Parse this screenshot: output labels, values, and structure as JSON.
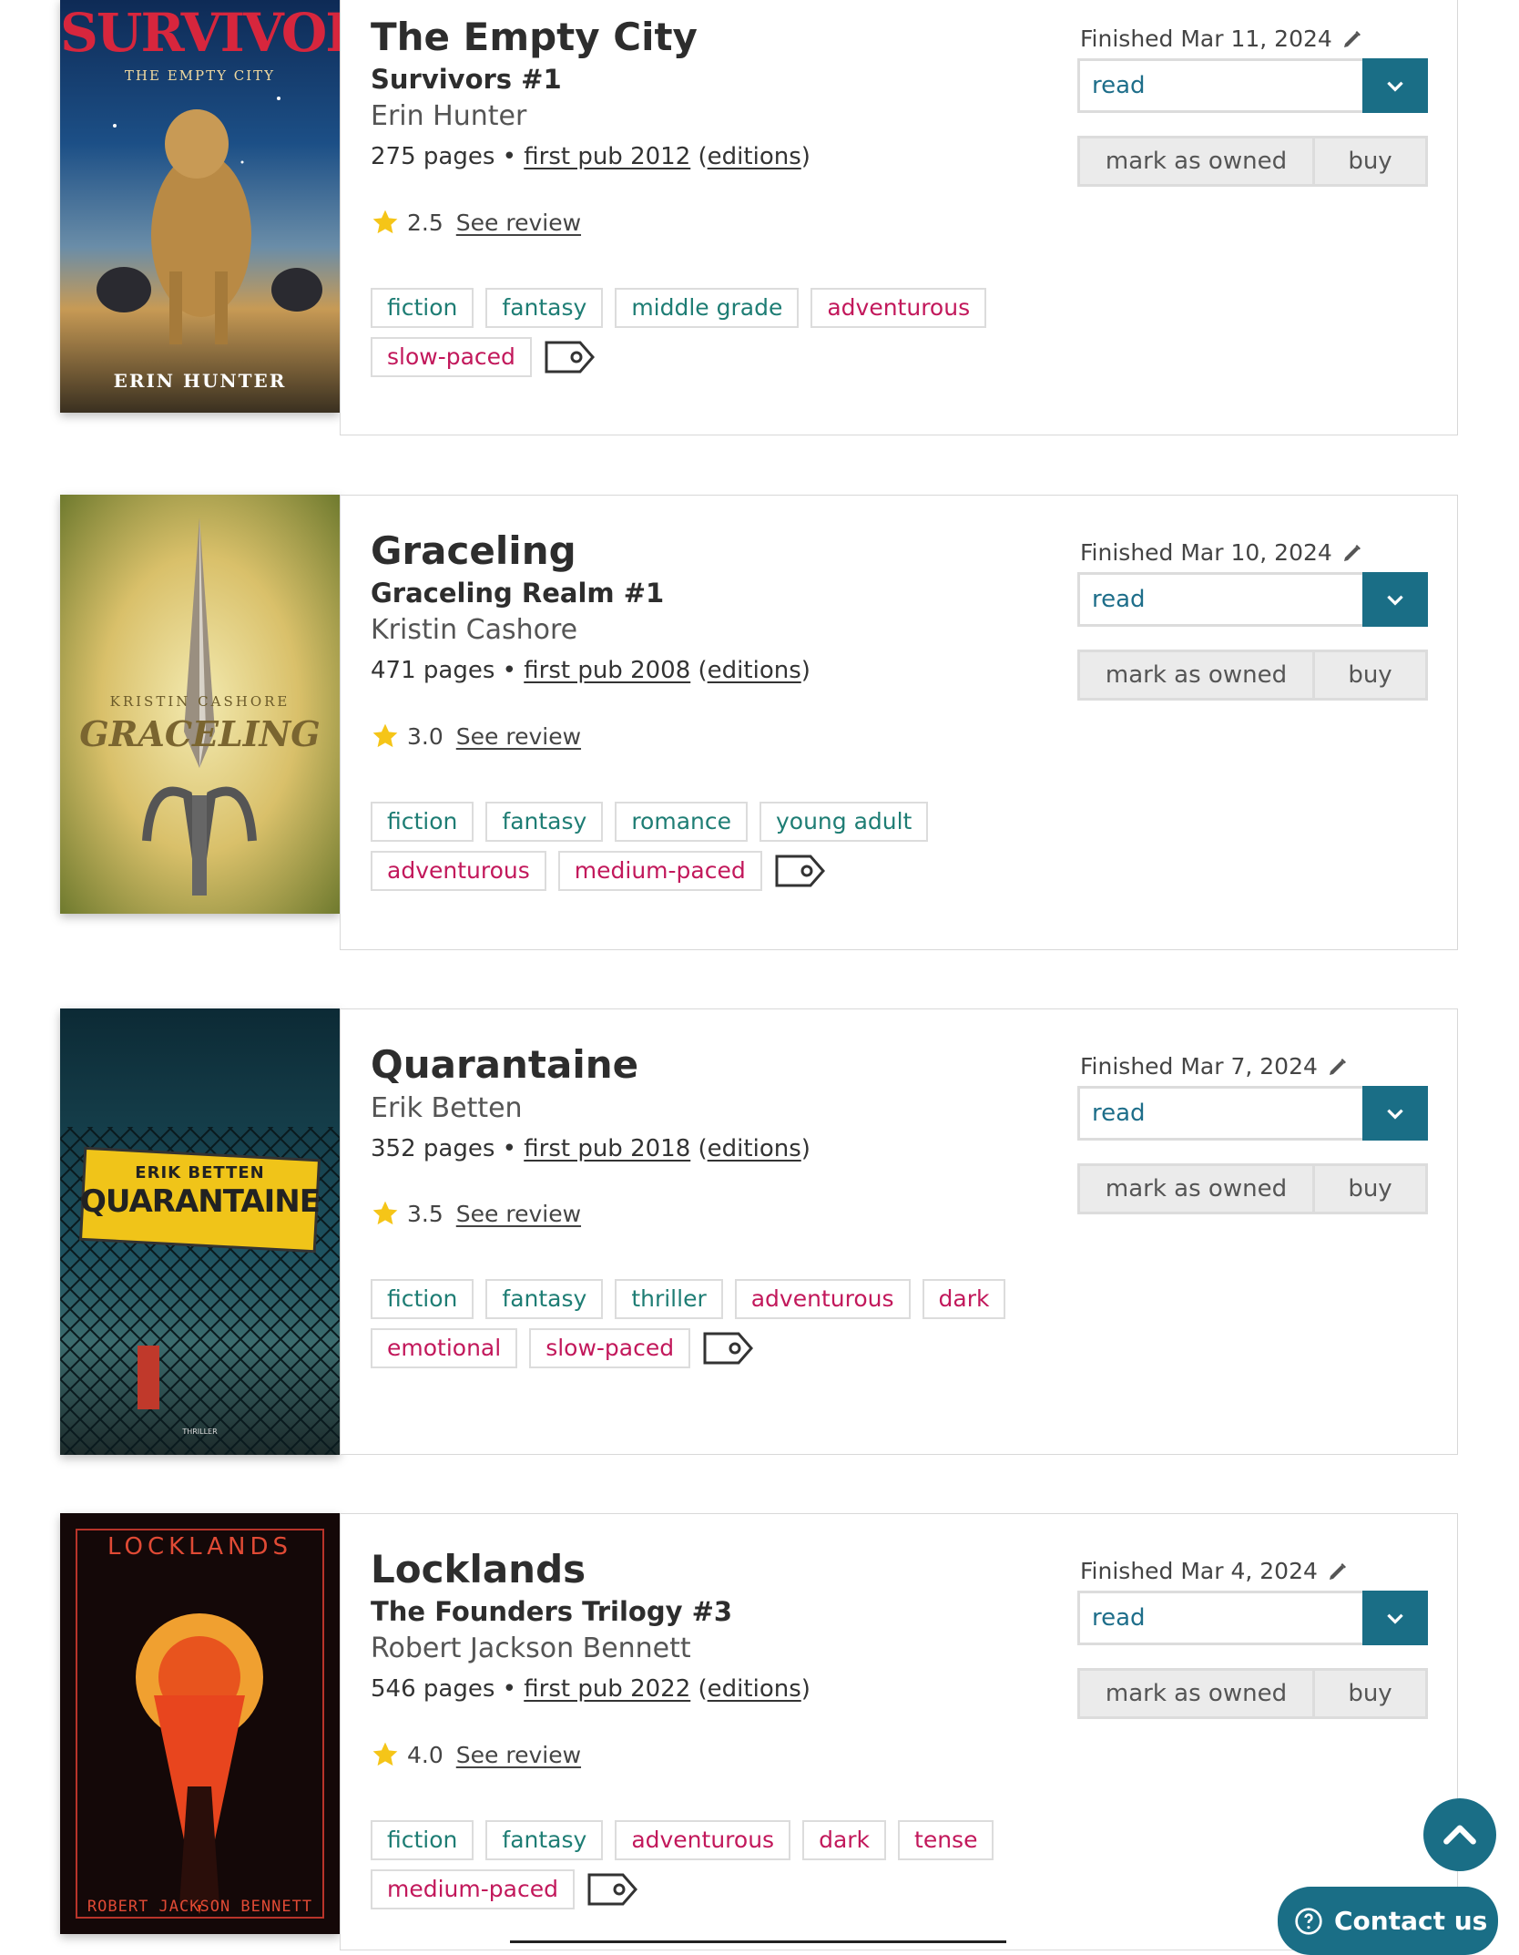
{
  "books": [
    {
      "title": "The Empty City",
      "series": "Survivors #1",
      "author": "Erin Hunter",
      "pages": "275 pages",
      "first_pub": "first pub 2012",
      "editions": "editions",
      "rating": "2.5",
      "see_review": "See review",
      "finished": "Finished Mar 11, 2024",
      "status": "read",
      "mark_owned": "mark as owned",
      "buy": "buy",
      "tags": [
        {
          "label": "fiction",
          "color": "green"
        },
        {
          "label": "fantasy",
          "color": "green"
        },
        {
          "label": "middle grade",
          "color": "green"
        },
        {
          "label": "adventurous",
          "color": "pink"
        },
        {
          "label": "slow-paced",
          "color": "pink"
        }
      ],
      "cover": {
        "top_text": "SURVIVORS",
        "sub_text": "THE EMPTY CITY",
        "byline": "ERIN HUNTER"
      }
    },
    {
      "title": "Graceling",
      "series": "Graceling Realm #1",
      "author": "Kristin Cashore",
      "pages": "471 pages",
      "first_pub": "first pub 2008",
      "editions": "editions",
      "rating": "3.0",
      "see_review": "See review",
      "finished": "Finished Mar 10, 2024",
      "status": "read",
      "mark_owned": "mark as owned",
      "buy": "buy",
      "tags": [
        {
          "label": "fiction",
          "color": "green"
        },
        {
          "label": "fantasy",
          "color": "green"
        },
        {
          "label": "romance",
          "color": "green"
        },
        {
          "label": "young adult",
          "color": "green"
        },
        {
          "label": "adventurous",
          "color": "pink"
        },
        {
          "label": "medium-paced",
          "color": "pink"
        }
      ],
      "cover": {
        "top_text": "KRISTIN CASHORE",
        "sub_text": "GRACELING",
        "byline": ""
      }
    },
    {
      "title": "Quarantaine",
      "series": "",
      "author": "Erik Betten",
      "pages": "352 pages",
      "first_pub": "first pub 2018",
      "editions": "editions",
      "rating": "3.5",
      "see_review": "See review",
      "finished": "Finished Mar 7, 2024",
      "status": "read",
      "mark_owned": "mark as owned",
      "buy": "buy",
      "tags": [
        {
          "label": "fiction",
          "color": "green"
        },
        {
          "label": "fantasy",
          "color": "green"
        },
        {
          "label": "thriller",
          "color": "green"
        },
        {
          "label": "adventurous",
          "color": "pink"
        },
        {
          "label": "dark",
          "color": "pink"
        },
        {
          "label": "emotional",
          "color": "pink"
        },
        {
          "label": "slow-paced",
          "color": "pink"
        }
      ],
      "cover": {
        "top_text": "ERIK BETTEN",
        "sub_text": "QUARANTAINE",
        "byline": "THRILLER"
      }
    },
    {
      "title": "Locklands",
      "series": "The Founders Trilogy #3",
      "author": "Robert Jackson Bennett",
      "pages": "546 pages",
      "first_pub": "first pub 2022",
      "editions": "editions",
      "rating": "4.0",
      "see_review": "See review",
      "finished": "Finished Mar 4, 2024",
      "status": "read",
      "mark_owned": "mark as owned",
      "buy": "buy",
      "tags": [
        {
          "label": "fiction",
          "color": "green"
        },
        {
          "label": "fantasy",
          "color": "green"
        },
        {
          "label": "adventurous",
          "color": "pink"
        },
        {
          "label": "dark",
          "color": "pink"
        },
        {
          "label": "tense",
          "color": "pink"
        },
        {
          "label": "medium-paced",
          "color": "pink"
        }
      ],
      "cover": {
        "top_text": "LOCKLANDS",
        "sub_text": "",
        "byline": "ROBERT JACKSON BENNETT"
      }
    }
  ],
  "floating": {
    "contact_label": "Contact us"
  },
  "colors": {
    "accent": "#1a6e86",
    "tag_green": "#1e7d74",
    "tag_pink": "#c2185b",
    "star": "#f5c518"
  },
  "icons": {
    "edit": "pencil-icon",
    "dropdown": "chevron-down-icon",
    "add_tag": "tag-icon",
    "scroll_top": "chevron-up-icon",
    "contact": "question-icon"
  }
}
